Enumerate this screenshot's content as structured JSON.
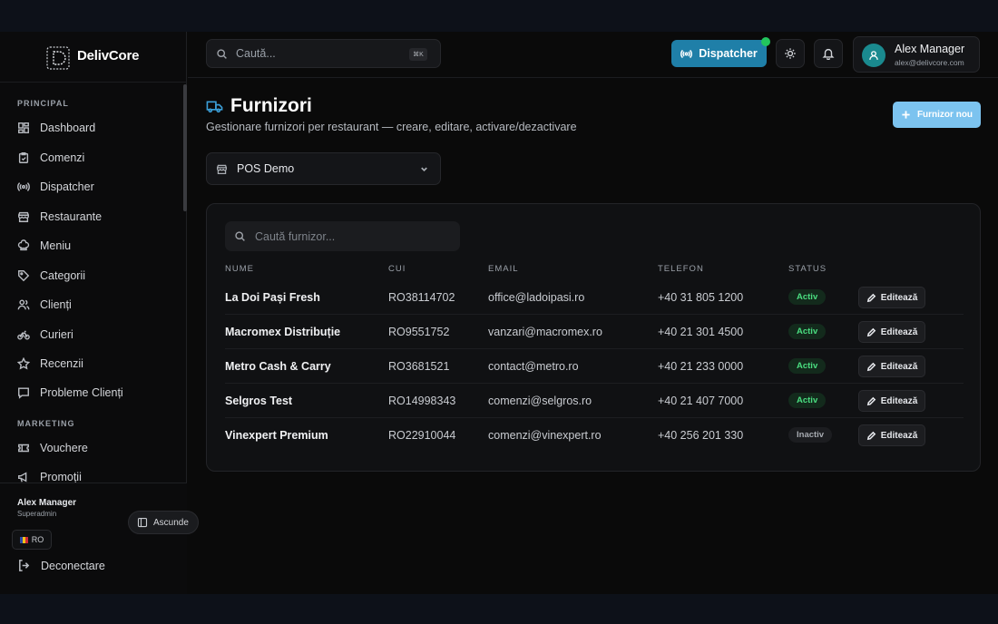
{
  "brand": {
    "name": "DelivCore"
  },
  "sidebar": {
    "sections": [
      {
        "label": "PRINCIPAL"
      },
      {
        "label": "MARKETING"
      }
    ],
    "items": [
      {
        "label": "Dashboard",
        "icon": "dashboard-icon"
      },
      {
        "label": "Comenzi",
        "icon": "clipboard-icon"
      },
      {
        "label": "Dispatcher",
        "icon": "radio-icon"
      },
      {
        "label": "Restaurante",
        "icon": "store-icon"
      },
      {
        "label": "Meniu",
        "icon": "chef-hat-icon"
      },
      {
        "label": "Categorii",
        "icon": "tag-icon"
      },
      {
        "label": "Clienți",
        "icon": "users-icon"
      },
      {
        "label": "Curieri",
        "icon": "bike-icon"
      },
      {
        "label": "Recenzii",
        "icon": "star-icon"
      },
      {
        "label": "Probleme Clienți",
        "icon": "message-icon"
      },
      {
        "label": "Vouchere",
        "icon": "ticket-icon"
      },
      {
        "label": "Promoții",
        "icon": "megaphone-icon"
      }
    ],
    "footer": {
      "user_name": "Alex Manager",
      "user_role": "Superadmin",
      "hide_label": "Ascunde",
      "lang": "RO",
      "logout_label": "Deconectare"
    }
  },
  "header": {
    "search_placeholder": "Caută...",
    "search_shortcut": "⌘K",
    "dispatcher_label": "Dispatcher",
    "user_name": "Alex Manager",
    "user_email": "alex@delivcore.com"
  },
  "page": {
    "title": "Furnizori",
    "subtitle": "Gestionare furnizori per restaurant — creare, editare, activare/dezactivare",
    "new_button": "Furnizor nou",
    "restaurant_select": "POS Demo"
  },
  "table": {
    "search_placeholder": "Caută furnizor...",
    "columns": [
      "NUME",
      "CUI",
      "EMAIL",
      "TELEFON",
      "STATUS"
    ],
    "edit_label": "Editează",
    "rows": [
      {
        "name": "La Doi Pași Fresh",
        "cui": "RO38114702",
        "email": "office@ladoipasi.ro",
        "phone": "+40 31 805 1200",
        "status": "Activ"
      },
      {
        "name": "Macromex Distribuție",
        "cui": "RO9551752",
        "email": "vanzari@macromex.ro",
        "phone": "+40 21 301 4500",
        "status": "Activ"
      },
      {
        "name": "Metro Cash & Carry",
        "cui": "RO3681521",
        "email": "contact@metro.ro",
        "phone": "+40 21 233 0000",
        "status": "Activ"
      },
      {
        "name": "Selgros Test",
        "cui": "RO14998343",
        "email": "comenzi@selgros.ro",
        "phone": "+40 21 407 7000",
        "status": "Activ"
      },
      {
        "name": "Vinexpert Premium",
        "cui": "RO22910044",
        "email": "comenzi@vinexpert.ro",
        "phone": "+40 256 201 330",
        "status": "Inactiv"
      }
    ]
  },
  "colors": {
    "accent": "#1f7fa8",
    "primary_button": "#7cc3ef",
    "active_green": "#4ade80",
    "title_icon": "#3b9fd8"
  }
}
